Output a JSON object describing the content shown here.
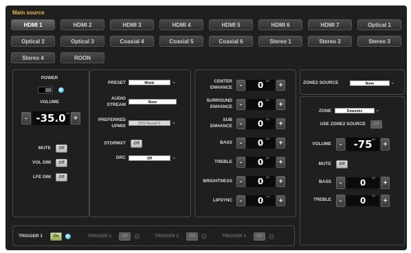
{
  "title": "Main source",
  "sources": [
    "HDMI 1",
    "HDMI 2",
    "HDMI 3",
    "HDMI 4",
    "HDMI 5",
    "HDMI 6",
    "HDMI 7",
    "Optical 1",
    "Optical 2",
    "Optical 3",
    "Coaxial 4",
    "Coaxial 5",
    "Coaxial 6",
    "Stereo 1",
    "Stereo 2",
    "Stereo 3",
    "Stereo 4",
    "ROON"
  ],
  "selected_source": "HDMI 1",
  "left": {
    "power_label": "POWER",
    "volume_label": "VOLUME",
    "volume_value": "-35.0",
    "volume_unit": "dB",
    "mute_label": "MUTE",
    "mute_state": "Off",
    "voldim_label": "VOL DIM",
    "voldim_state": "Off",
    "lfedim_label": "LFE DIM",
    "lfedim_state": "Off"
  },
  "middle": {
    "preset_label": "PRESET",
    "preset_value": "Movie",
    "audio_stream_label_1": "AUDIO",
    "audio_stream_label_2": "STREAM",
    "audio_stream_value": "None",
    "upmix_label_1": "PREFERRED",
    "upmix_label_2": "UPMIX",
    "upmix_value": "DTS Neural:X",
    "stormxt_label": "STORMXT",
    "stormxt_state": "Off",
    "drc_label": "DRC",
    "drc_value": "Off"
  },
  "adjust": [
    {
      "label1": "CENTER",
      "label2": "ENHANCE",
      "value": "0",
      "unit": "dB"
    },
    {
      "label1": "SURROUND",
      "label2": "ENHANCE",
      "value": "0",
      "unit": "dB"
    },
    {
      "label1": "SUB",
      "label2": "ENHANCE",
      "value": "0",
      "unit": "dB"
    },
    {
      "label1": "BASS",
      "label2": "",
      "value": "0",
      "unit": "dB"
    },
    {
      "label1": "TREBLE",
      "label2": "",
      "value": "0",
      "unit": "dB"
    },
    {
      "label1": "BRIGHTNESS",
      "label2": "",
      "value": "0",
      "unit": "dB"
    },
    {
      "label1": "LIPSYNC",
      "label2": "",
      "value": "0",
      "unit": "ms"
    }
  ],
  "zone2": {
    "source_label": "ZONE2 SOURCE",
    "source_value": "None",
    "zone_label": "ZONE",
    "zone_value": "Downmix",
    "use_z2_label": "USE ZONE2 SOURCE",
    "use_z2_state": "Off",
    "volume_label": "VOLUME",
    "volume_value": "-75",
    "volume_unit": "dB",
    "mute_label": "MUTE",
    "mute_state": "Off",
    "bass_label": "BASS",
    "bass_value": "0",
    "bass_unit": "dB",
    "treble_label": "TREBLE",
    "treble_value": "0",
    "treble_unit": "dB"
  },
  "triggers": [
    {
      "label": "TRIGGER 1",
      "state": "On",
      "active": true
    },
    {
      "label": "TRIGGER 2",
      "state": "Off",
      "active": false
    },
    {
      "label": "TRIGGER 3",
      "state": "Off",
      "active": false
    },
    {
      "label": "TRIGGER 4",
      "state": "Off",
      "active": false
    }
  ],
  "colors": {
    "accent": "#e8b845",
    "led": "#4cc7e6",
    "background": "#1f1f1f"
  }
}
